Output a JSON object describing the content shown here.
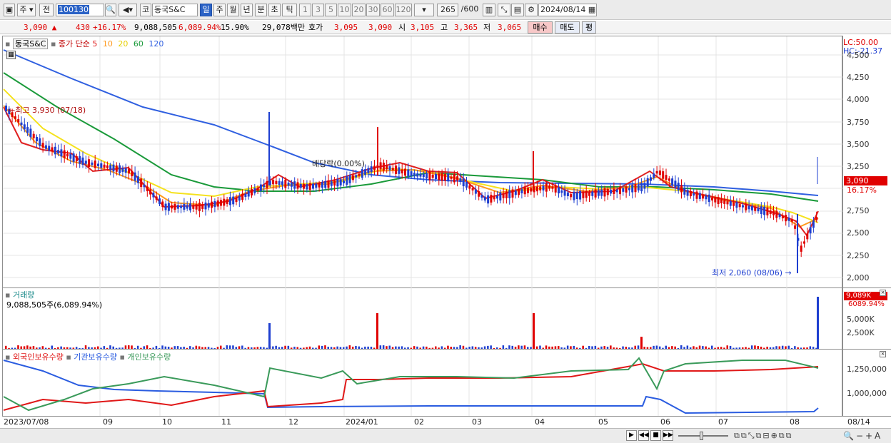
{
  "toolbar": {
    "period_week": "주",
    "prev_label": "전",
    "code": "100130",
    "market_tag": "코",
    "stock_name": "동국S&C",
    "periods": [
      "일",
      "주",
      "월",
      "년",
      "분",
      "초",
      "틱"
    ],
    "intervals": [
      "1",
      "3",
      "5",
      "10",
      "20",
      "30",
      "60",
      "120"
    ],
    "count": "265",
    "count_total": "/600",
    "date": "2024/08/14"
  },
  "quote": {
    "price": "3,090",
    "change": "430",
    "change_pct": "+16.17%",
    "volume": "9,088,505",
    "volume_pct": "6,089.94%",
    "turnover": "15.90%",
    "amount": "29,078백만",
    "ask_label": "호가",
    "ask": "3,095",
    "bid": "3,090",
    "open_label": "시",
    "open": "3,105",
    "high_label": "고",
    "high": "3,365",
    "low_label": "저",
    "low": "3,065",
    "buy_label": "매수",
    "sell_label": "매도",
    "eval_label": "평"
  },
  "price_pane": {
    "name": "동국S&C",
    "ma_title": "종가 단순",
    "ma_periods": [
      "5",
      "10",
      "20",
      "60",
      "120"
    ],
    "high_note": "최고 3,930 (07/18)",
    "low_note": "최저 2,060 (08/06)",
    "dividend_note": "배당락(0.00%)",
    "lc_label": "LC:50.00",
    "hc_label": "HC:-21.37",
    "current_price_tag": "3,090",
    "current_pct_tag": "16.17%",
    "yticks": [
      "4,500",
      "4,250",
      "4,000",
      "3,750",
      "3,500",
      "3,250",
      "3,000",
      "2,750",
      "2,500",
      "2,250",
      "2,000"
    ]
  },
  "volume_pane": {
    "title": "거래량",
    "value": "9,088,505주(6,089.94%)",
    "tag_value": "9,089K",
    "tag_pct": "6089.94%",
    "yticks": [
      "5,000K",
      "2,500K"
    ]
  },
  "holding_pane": {
    "series": [
      "외국인보유수량",
      "기관보유수량",
      "개인보유수량"
    ],
    "yticks": [
      "1,250,000",
      "1,000,000"
    ]
  },
  "x_axis": {
    "labels": [
      "2023/07/08",
      "09",
      "10",
      "11",
      "12",
      "2024/01",
      "02",
      "03",
      "04",
      "05",
      "06",
      "07",
      "08",
      "08/14"
    ]
  },
  "colors": {
    "up": "#e00000",
    "down": "#1e3fd0",
    "ma5": "#e02020",
    "ma10": "#ff9a1e",
    "ma20": "#f5e21e",
    "ma60": "#1a9a3a",
    "ma120": "#2f5fe0",
    "foreign": "#e01818",
    "institution": "#2a5ce0",
    "individual": "#3a9a5a"
  }
}
